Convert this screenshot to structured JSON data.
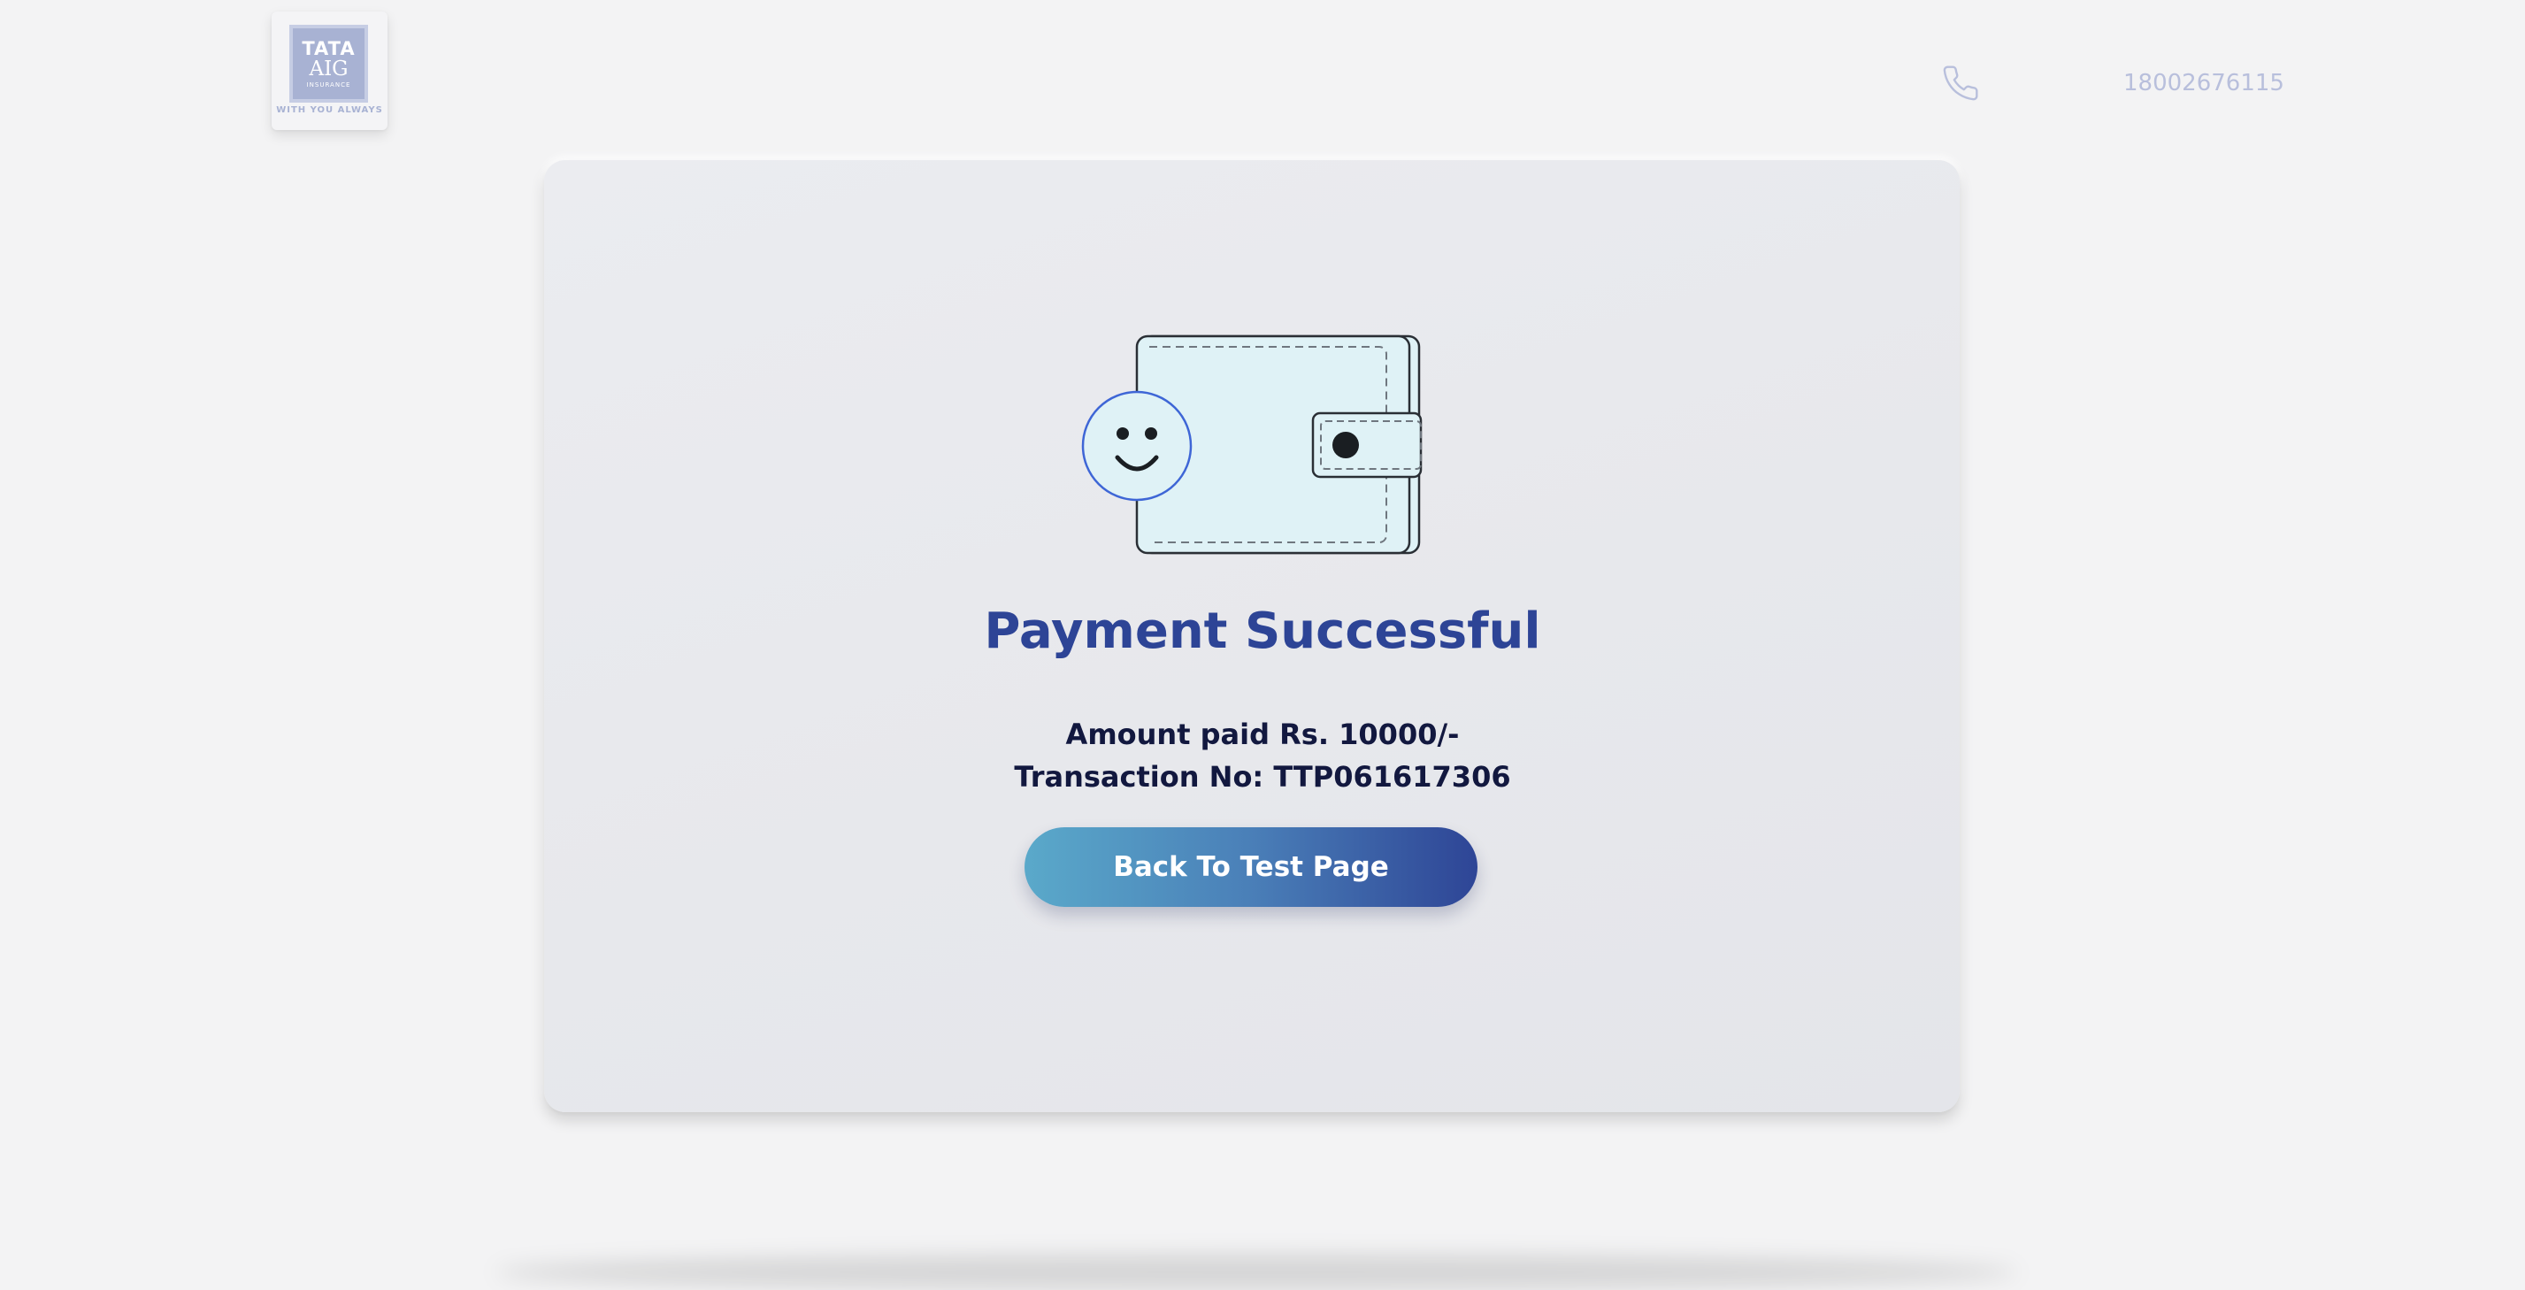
{
  "header": {
    "logo": {
      "line1": "TATA",
      "line2": "AIG",
      "line3": "INSURANCE",
      "tagline": "WITH YOU ALWAYS"
    },
    "phone_icon": "phone-icon",
    "phone_number": "18002676115"
  },
  "payment": {
    "illustration": "wallet-smiley-icon",
    "title": "Payment Successful",
    "amount_text": "Amount paid Rs. 10000/-",
    "transaction_text": "Transaction No: TTP061617306",
    "back_button_label": "Back To Test Page"
  },
  "colors": {
    "background": "#f3f3f4",
    "card": "#e8e9ed",
    "title": "#2d4496",
    "text": "#12183f",
    "button_start": "#5aa9ca",
    "button_end": "#2e4596",
    "header_muted": "#b8bfdc"
  }
}
